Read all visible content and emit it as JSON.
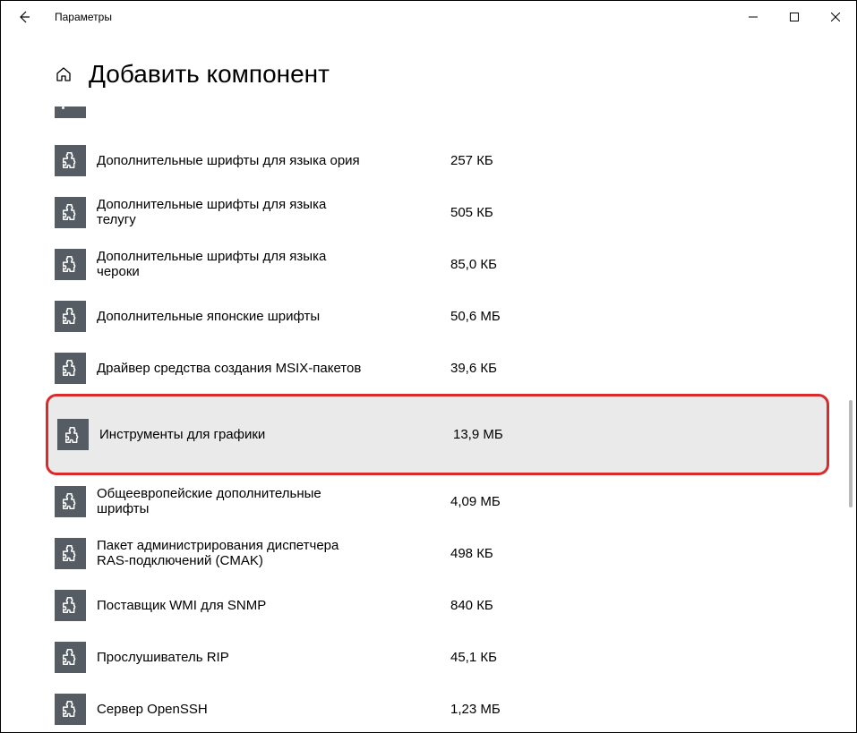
{
  "window": {
    "title": "Параметры"
  },
  "header": {
    "title": "Добавить компонент"
  },
  "features": [
    {
      "name": "Дополнительные шрифты для языка ория",
      "size": "257 КБ",
      "highlighted": false
    },
    {
      "name": "Дополнительные шрифты для языка телугу",
      "size": "505 КБ",
      "highlighted": false
    },
    {
      "name": "Дополнительные шрифты для языка чероки",
      "size": "85,0 КБ",
      "highlighted": false
    },
    {
      "name": "Дополнительные японские шрифты",
      "size": "50,6 МБ",
      "highlighted": false
    },
    {
      "name": "Драйвер средства создания MSIX-пакетов",
      "size": "39,6 КБ",
      "highlighted": false
    },
    {
      "name": "Инструменты для графики",
      "size": "13,9 МБ",
      "highlighted": true
    },
    {
      "name": "Общеевропейские дополнительные шрифты",
      "size": "4,09 МБ",
      "highlighted": false
    },
    {
      "name": "Пакет администрирования диспетчера RAS-подключений (CMAK)",
      "size": "498 КБ",
      "highlighted": false
    },
    {
      "name": "Поставщик WMI для SNMP",
      "size": "840 КБ",
      "highlighted": false
    },
    {
      "name": "Прослушиватель RIP",
      "size": "45,1 КБ",
      "highlighted": false
    },
    {
      "name": "Сервер OpenSSH",
      "size": "1,23 МБ",
      "highlighted": false
    }
  ]
}
